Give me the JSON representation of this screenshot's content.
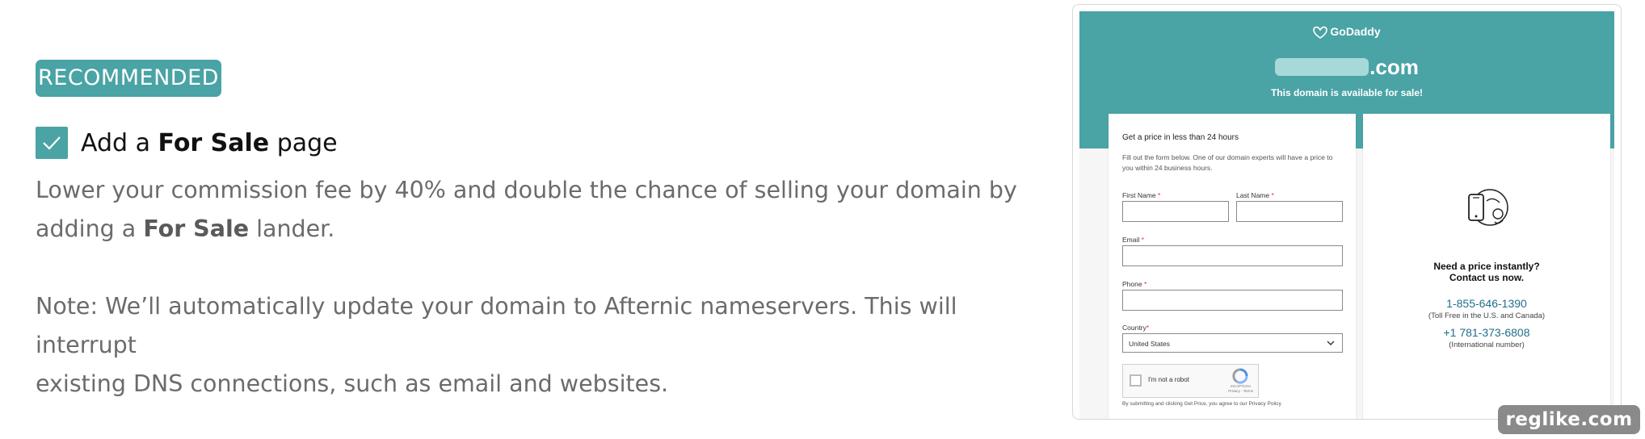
{
  "badge": "RECOMMENDED",
  "option": {
    "label_pre": "Add a ",
    "label_bold": "For Sale",
    "label_post": " page",
    "checked": true,
    "desc_line1": "Lower your commission fee by 40% and double the chance of selling your domain by",
    "desc_pre": "adding a ",
    "desc_bold": "For Sale",
    "desc_post": " lander.",
    "note_line1": "Note: We’ll automatically update your domain to Afternic nameservers. This will interrupt",
    "note_line2": "existing DNS connections, such as email and websites."
  },
  "preview": {
    "brand": "GoDaddy",
    "domain_suffix": ".com",
    "available": "This domain is available for sale!",
    "form": {
      "title": "Get a price in less than 24 hours",
      "description": "Fill out the form below. One of our domain experts will have a price to you within 24 business hours.",
      "first_name": "First Name",
      "last_name": "Last Name",
      "email": "Email",
      "phone": "Phone",
      "country_label": "Country",
      "country_value": "United States",
      "required_mark": "*",
      "captcha_label": "I'm not a robot",
      "captcha_brand": "reCAPTCHA",
      "captcha_links": "Privacy - Terms",
      "terms": "By submitting and clicking Get Price, you agree to our Privacy Policy"
    },
    "contact": {
      "title_line1": "Need a price instantly?",
      "title_line2": "Contact us now.",
      "phone1": "1-855-646-1390",
      "phone1_note": "(Toll Free in the U.S. and Canada)",
      "phone2": "+1 781-373-6808",
      "phone2_note": "(International number)"
    }
  },
  "watermark": "reglike.com",
  "colors": {
    "accent": "#4aa3a4",
    "text_gray": "#6b6b6b",
    "phone_link": "#1f6e8a"
  }
}
